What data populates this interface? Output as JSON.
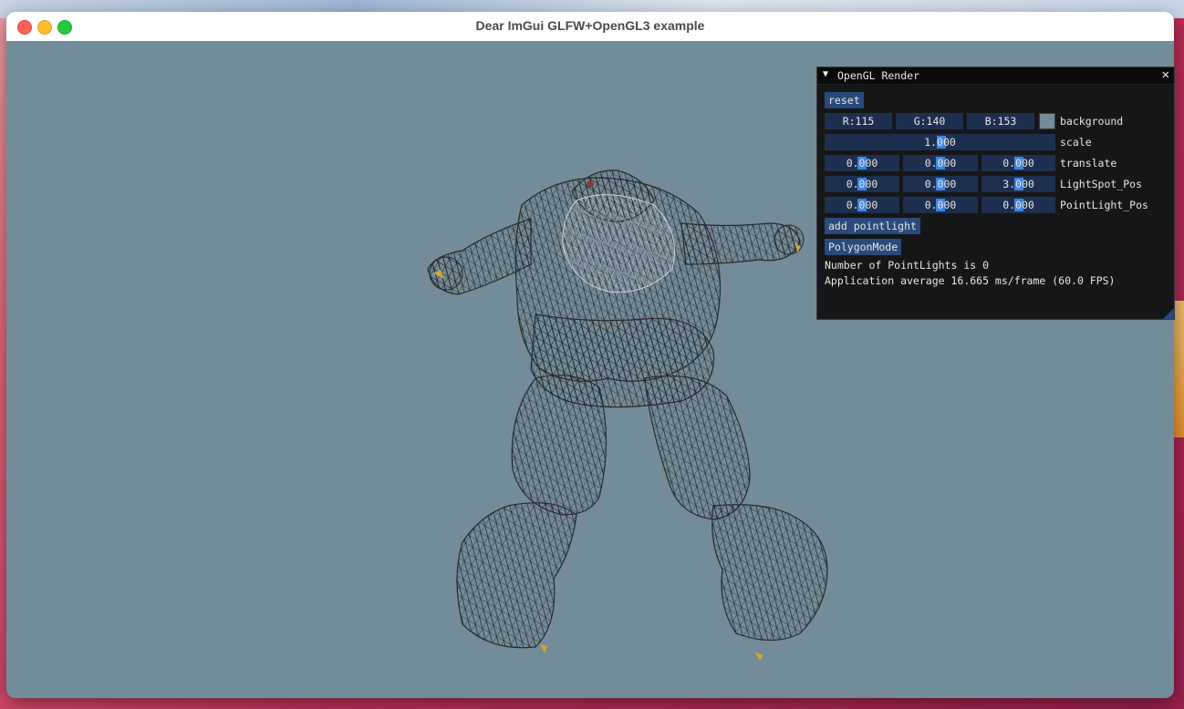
{
  "window": {
    "title": "Dear ImGui GLFW+OpenGL3 example",
    "background_color": "#738c99"
  },
  "panel": {
    "title": "OpenGL Render",
    "collapse_icon": "triangle-down-icon",
    "close_icon": "close-icon",
    "reset_label": "reset",
    "background": {
      "r_text": "R:115",
      "g_text": "G:140",
      "b_text": "B:153",
      "swatch_color": "#738c99",
      "label": "background"
    },
    "scale": {
      "value": "1.000",
      "label": "scale"
    },
    "translate": {
      "x": "0.000",
      "y": "0.000",
      "z": "0.000",
      "label": "translate"
    },
    "lightspot_pos": {
      "x": "0.000",
      "y": "0.000",
      "z": "3.000",
      "label": "LightSpot_Pos"
    },
    "pointlight_pos": {
      "x": "0.000",
      "y": "0.000",
      "z": "0.000",
      "label": "PointLight_Pos"
    },
    "add_pointlight_label": "add pointlight",
    "polygonmode_label": "PolygonMode",
    "pointlights_text": "Number of PointLights is 0",
    "framerate_text": "Application average 16.665 ms/frame (60.0 FPS)",
    "accent_color": "#294a7a"
  },
  "scene": {
    "model": "wireframe-humanoid-model",
    "render_mode": "wireframe"
  }
}
